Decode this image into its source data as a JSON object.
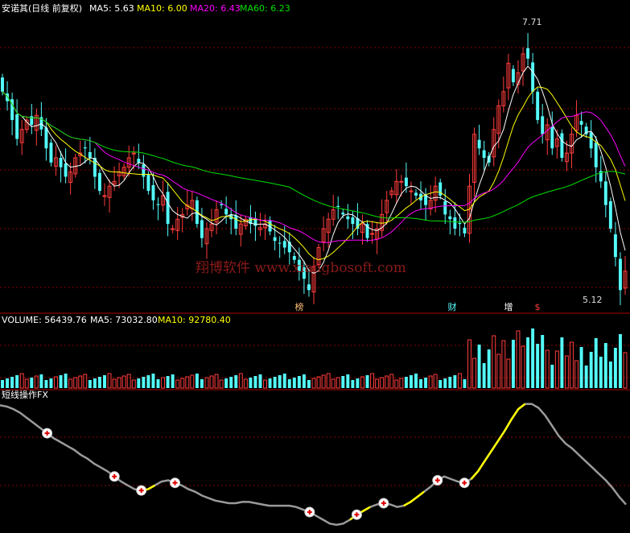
{
  "header": {
    "title": "安诺其(日线 前复权)",
    "ma5": "MA5: 5.63",
    "ma10": "MA10: 6.00",
    "ma20": "MA20: 6.43",
    "ma60": "MA60: 6.23"
  },
  "watermark": "翔博软件 www.xiangbosoft.com",
  "markers": [
    "榜",
    "财",
    "增",
    "$"
  ],
  "price_labels": {
    "high": "7.71",
    "low": "5.12"
  },
  "volume_header": {
    "volume": "VOLUME: 56439.76",
    "ma5": "MA5: 73032.80",
    "ma10": "MA10: 92780.40"
  },
  "indicator_title": "短线操作FX",
  "colors": {
    "up": "#ff3c3c",
    "down": "#54fcfc",
    "ma5": "#ffffff",
    "ma10": "#ffff00",
    "ma20": "#ff00ff",
    "ma60": "#00e000",
    "grid": "#8b0000",
    "indicator_line": "#9a9a9a",
    "indicator_highlight": "#ffff00"
  },
  "chart_data": [
    {
      "type": "candlestick",
      "title": "安诺其(日线 前复权)",
      "ylim": [
        5.0,
        8.0
      ],
      "high_label": 7.71,
      "low_label": 5.12,
      "series": [
        {
          "name": "MA5",
          "color": "#ffffff"
        },
        {
          "name": "MA10",
          "color": "#ffff00"
        },
        {
          "name": "MA20",
          "color": "#ff00ff"
        },
        {
          "name": "MA60",
          "color": "#00e000"
        }
      ],
      "close": [
        7.2,
        7.1,
        6.9,
        6.7,
        6.8,
        6.9,
        6.85,
        6.95,
        6.8,
        6.6,
        6.45,
        6.5,
        6.4,
        6.3,
        6.35,
        6.5,
        6.55,
        6.6,
        6.5,
        6.3,
        6.15,
        6.1,
        6.2,
        6.25,
        6.35,
        6.4,
        6.5,
        6.55,
        6.45,
        6.3,
        6.15,
        6.05,
        6.0,
        6.1,
        5.8,
        5.75,
        5.85,
        5.9,
        6.0,
        6.05,
        5.8,
        5.65,
        5.75,
        5.8,
        5.95,
        6.0,
        5.9,
        5.85,
        5.75,
        5.8,
        5.85,
        5.8,
        5.78,
        5.76,
        5.8,
        5.72,
        5.62,
        5.6,
        5.55,
        5.5,
        5.42,
        5.3,
        5.22,
        5.1,
        5.35,
        5.55,
        5.75,
        5.85,
        5.95,
        5.98,
        5.9,
        5.85,
        5.8,
        5.75,
        5.8,
        5.65,
        5.7,
        5.75,
        5.9,
        6.05,
        6.15,
        6.25,
        6.25,
        6.2,
        6.15,
        6.1,
        6.05,
        6.0,
        6.05,
        6.2,
        6.1,
        5.9,
        5.85,
        5.75,
        5.8,
        5.7,
        6.2,
        6.75,
        6.6,
        6.5,
        6.45,
        6.8,
        7.05,
        7.2,
        7.5,
        7.3,
        7.4,
        7.6,
        7.55,
        7.2,
        6.9,
        6.75,
        6.85,
        6.6,
        6.7,
        6.5,
        6.55,
        6.75,
        6.95,
        6.85,
        6.75,
        6.6,
        6.4,
        6.25,
        6.0,
        5.75,
        5.45,
        5.1,
        5.3
      ],
      "markers": [
        "榜",
        "财",
        "增",
        "$"
      ]
    },
    {
      "type": "bar",
      "title": "VOLUME",
      "volume": 56439.76,
      "ma5": 73032.8,
      "ma10": 92780.4,
      "series": [
        {
          "name": "MA5",
          "color": "#ffffff"
        },
        {
          "name": "MA10",
          "color": "#ffff00"
        }
      ]
    },
    {
      "type": "line",
      "title": "短线操作FX",
      "values": [
        0.96,
        0.95,
        0.93,
        0.9,
        0.86,
        0.82,
        0.78,
        0.74,
        0.7,
        0.67,
        0.64,
        0.61,
        0.57,
        0.54,
        0.5,
        0.47,
        0.44,
        0.4,
        0.36,
        0.33,
        0.3,
        0.29,
        0.3,
        0.33,
        0.36,
        0.37,
        0.35,
        0.33,
        0.3,
        0.28,
        0.25,
        0.23,
        0.21,
        0.2,
        0.19,
        0.19,
        0.2,
        0.2,
        0.19,
        0.18,
        0.17,
        0.17,
        0.17,
        0.17,
        0.16,
        0.14,
        0.12,
        0.09,
        0.06,
        0.03,
        0.02,
        0.03,
        0.06,
        0.1,
        0.13,
        0.16,
        0.18,
        0.19,
        0.18,
        0.16,
        0.17,
        0.2,
        0.24,
        0.28,
        0.32,
        0.37,
        0.4,
        0.38,
        0.36,
        0.35,
        0.38,
        0.44,
        0.52,
        0.6,
        0.68,
        0.76,
        0.85,
        0.93,
        0.97,
        0.97,
        0.94,
        0.88,
        0.8,
        0.72,
        0.66,
        0.62,
        0.57,
        0.52,
        0.47,
        0.42,
        0.37,
        0.31,
        0.24,
        0.18
      ]
    }
  ]
}
